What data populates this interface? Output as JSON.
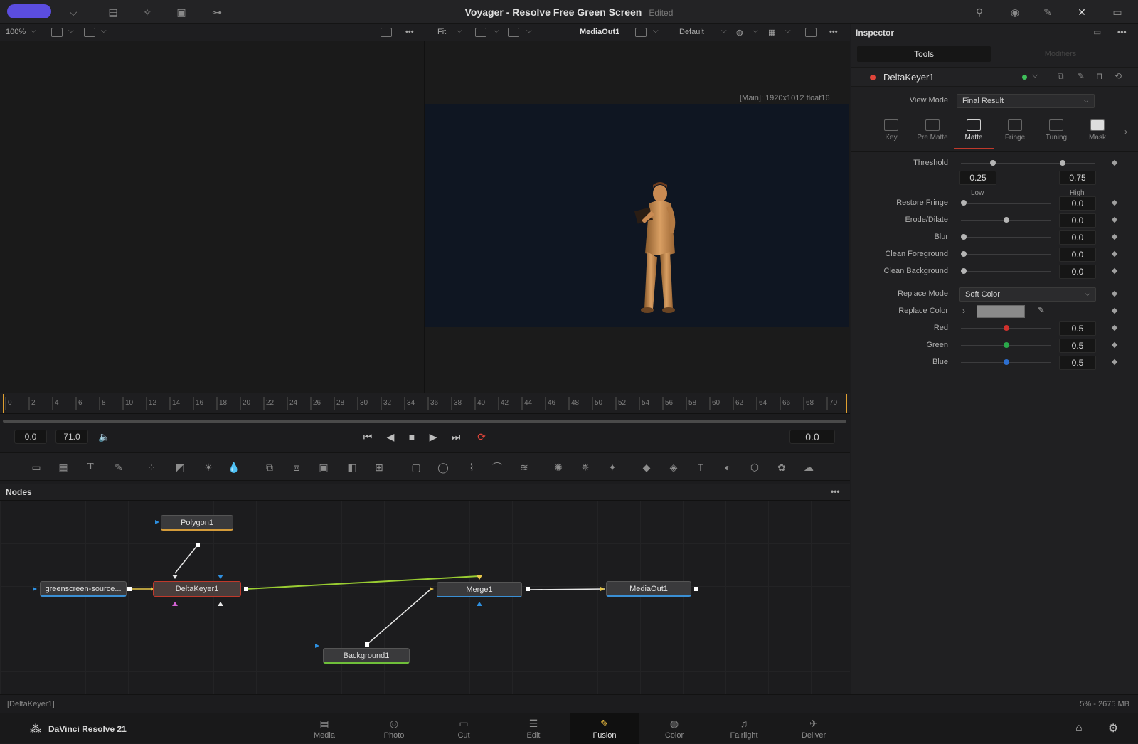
{
  "titlebar": {
    "title": "Voyager - Resolve Free Green Screen",
    "edited": "Edited"
  },
  "viewer_toolbar": {
    "zoom": "100%",
    "fit": "Fit",
    "output_node": "MediaOut1",
    "lut": "Default"
  },
  "viewer": {
    "resolution": "[Main]: 1920x1012 float16"
  },
  "timeline": {
    "ticks": [
      "0",
      "2",
      "4",
      "6",
      "8",
      "10",
      "12",
      "14",
      "16",
      "18",
      "20",
      "22",
      "24",
      "26",
      "28",
      "30",
      "32",
      "34",
      "36",
      "38",
      "40",
      "42",
      "44",
      "46",
      "48",
      "50",
      "52",
      "54",
      "56",
      "58",
      "60",
      "62",
      "64",
      "66",
      "68",
      "70"
    ],
    "start": "0.0",
    "end": "71.0",
    "current": "0.0"
  },
  "nodes_panel": {
    "title": "Nodes",
    "nodes": {
      "polygon": "Polygon1",
      "source": "greenscreen-source...",
      "keyer": "DeltaKeyer1",
      "merge": "Merge1",
      "mediaout": "MediaOut1",
      "background": "Background1"
    }
  },
  "inspector": {
    "title": "Inspector",
    "tabs": {
      "tools": "Tools",
      "modifiers": "Modifiers"
    },
    "node_name": "DeltaKeyer1",
    "view_mode_label": "View Mode",
    "view_mode_value": "Final Result",
    "subtabs": [
      "Key",
      "Pre Matte",
      "Matte",
      "Fringe",
      "Tuning",
      "Mask"
    ],
    "active_subtab": "Matte",
    "threshold": {
      "label": "Threshold",
      "low": "0.25",
      "high": "0.75",
      "low_label": "Low",
      "high_label": "High"
    },
    "params": [
      {
        "label": "Restore Fringe",
        "value": "0.0",
        "level": 0.0
      },
      {
        "label": "Erode/Dilate",
        "value": "0.0",
        "level": 0.5
      },
      {
        "label": "Blur",
        "value": "0.0",
        "level": 0.0
      },
      {
        "label": "Clean Foreground",
        "value": "0.0",
        "level": 0.0
      },
      {
        "label": "Clean Background",
        "value": "0.0",
        "level": 0.0
      }
    ],
    "replace_mode_label": "Replace Mode",
    "replace_mode_value": "Soft Color",
    "replace_color_label": "Replace Color",
    "colors": [
      {
        "label": "Red",
        "value": "0.5",
        "color": "#d0312d"
      },
      {
        "label": "Green",
        "value": "0.5",
        "color": "#2aa84a"
      },
      {
        "label": "Blue",
        "value": "0.5",
        "color": "#2d6fd0"
      }
    ]
  },
  "statusbar": {
    "left": "[DeltaKeyer1]",
    "right": "5% - 2675 MB"
  },
  "pagebar": {
    "app_name": "DaVinci Resolve 21",
    "pages": [
      "Media",
      "Photo",
      "Cut",
      "Edit",
      "Fusion",
      "Color",
      "Fairlight",
      "Deliver"
    ],
    "active_page": "Fusion"
  },
  "accent": "#5b4de0"
}
